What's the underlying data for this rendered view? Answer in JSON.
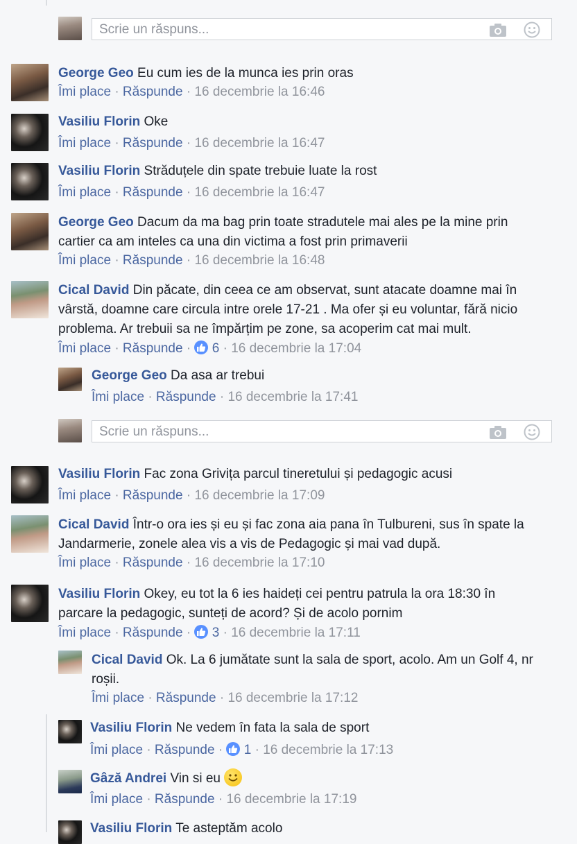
{
  "reply_placeholder": "Scrie un răspuns...",
  "actions": {
    "like": "Îmi place",
    "reply": "Răspunde",
    "separator": "·"
  },
  "comments": [
    {
      "author": "George Geo",
      "text": "Eu cum ies de la munca ies prin oras",
      "time": "16 decembrie la 16:46"
    },
    {
      "author": "Vasiliu Florin",
      "text": "Oke",
      "time": "16 decembrie la 16:47"
    },
    {
      "author": "Vasiliu Florin",
      "text": "Străduțele din spate trebuie luate la rost",
      "time": "16 decembrie la 16:47"
    },
    {
      "author": "George Geo",
      "text": "Dacum da ma bag prin toate stradutele mai ales pe la mine prin cartier ca am inteles ca una din victima a fost prin primaverii",
      "time": "16 decembrie la 16:48"
    },
    {
      "author": "Cical David",
      "text": "Din păcate, din ceea ce am observat, sunt atacate doamne mai în vârstă, doamne care circula intre orele 17-21 . Ma ofer și eu voluntar, fără nicio problema. Ar trebuii sa ne împărțim pe zone, sa acoperim cat mai mult.",
      "likes": "6",
      "time": "16 decembrie la 17:04"
    },
    {
      "author": "George Geo",
      "text": "Da asa ar trebui",
      "time": "16 decembrie la 17:41"
    },
    {
      "author": "Vasiliu Florin",
      "text": "Fac zona Grivița parcul tineretului și pedagogic acusi",
      "time": "16 decembrie la 17:09"
    },
    {
      "author": "Cical David",
      "text": "Într-o ora ies și eu și fac zona aia pana în Tulbureni, sus în spate la Jandarmerie, zonele alea vis a vis de Pedagogic și mai vad după.",
      "time": "16 decembrie la 17:10"
    },
    {
      "author": "Vasiliu Florin",
      "text": "Okey, eu tot la 6 ies haideți cei pentru patrula la ora 18:30 în parcare la pedagogic, sunteți de acord? Și de acolo pornim",
      "likes": "3",
      "time": "16 decembrie la 17:11"
    },
    {
      "author": "Cical David",
      "text": "Ok. La 6 jumătate sunt la sala de sport, acolo. Am un Golf 4, nr roșii.",
      "time": "16 decembrie la 17:12"
    },
    {
      "author": "Vasiliu Florin",
      "text": "Ne vedem în fata la sala de sport",
      "likes": "1",
      "time": "16 decembrie la 17:13"
    },
    {
      "author": "Gâză Andrei",
      "text": "Vin si eu",
      "time": "16 decembrie la 17:19"
    },
    {
      "author": "Vasiliu Florin",
      "text": "Te asteptăm acolo"
    }
  ],
  "colors": {
    "author": "#365899",
    "meta": "#90949c",
    "link": "#4b67a1",
    "like_badge": "#5890ff",
    "background": "#f6f7f9"
  }
}
